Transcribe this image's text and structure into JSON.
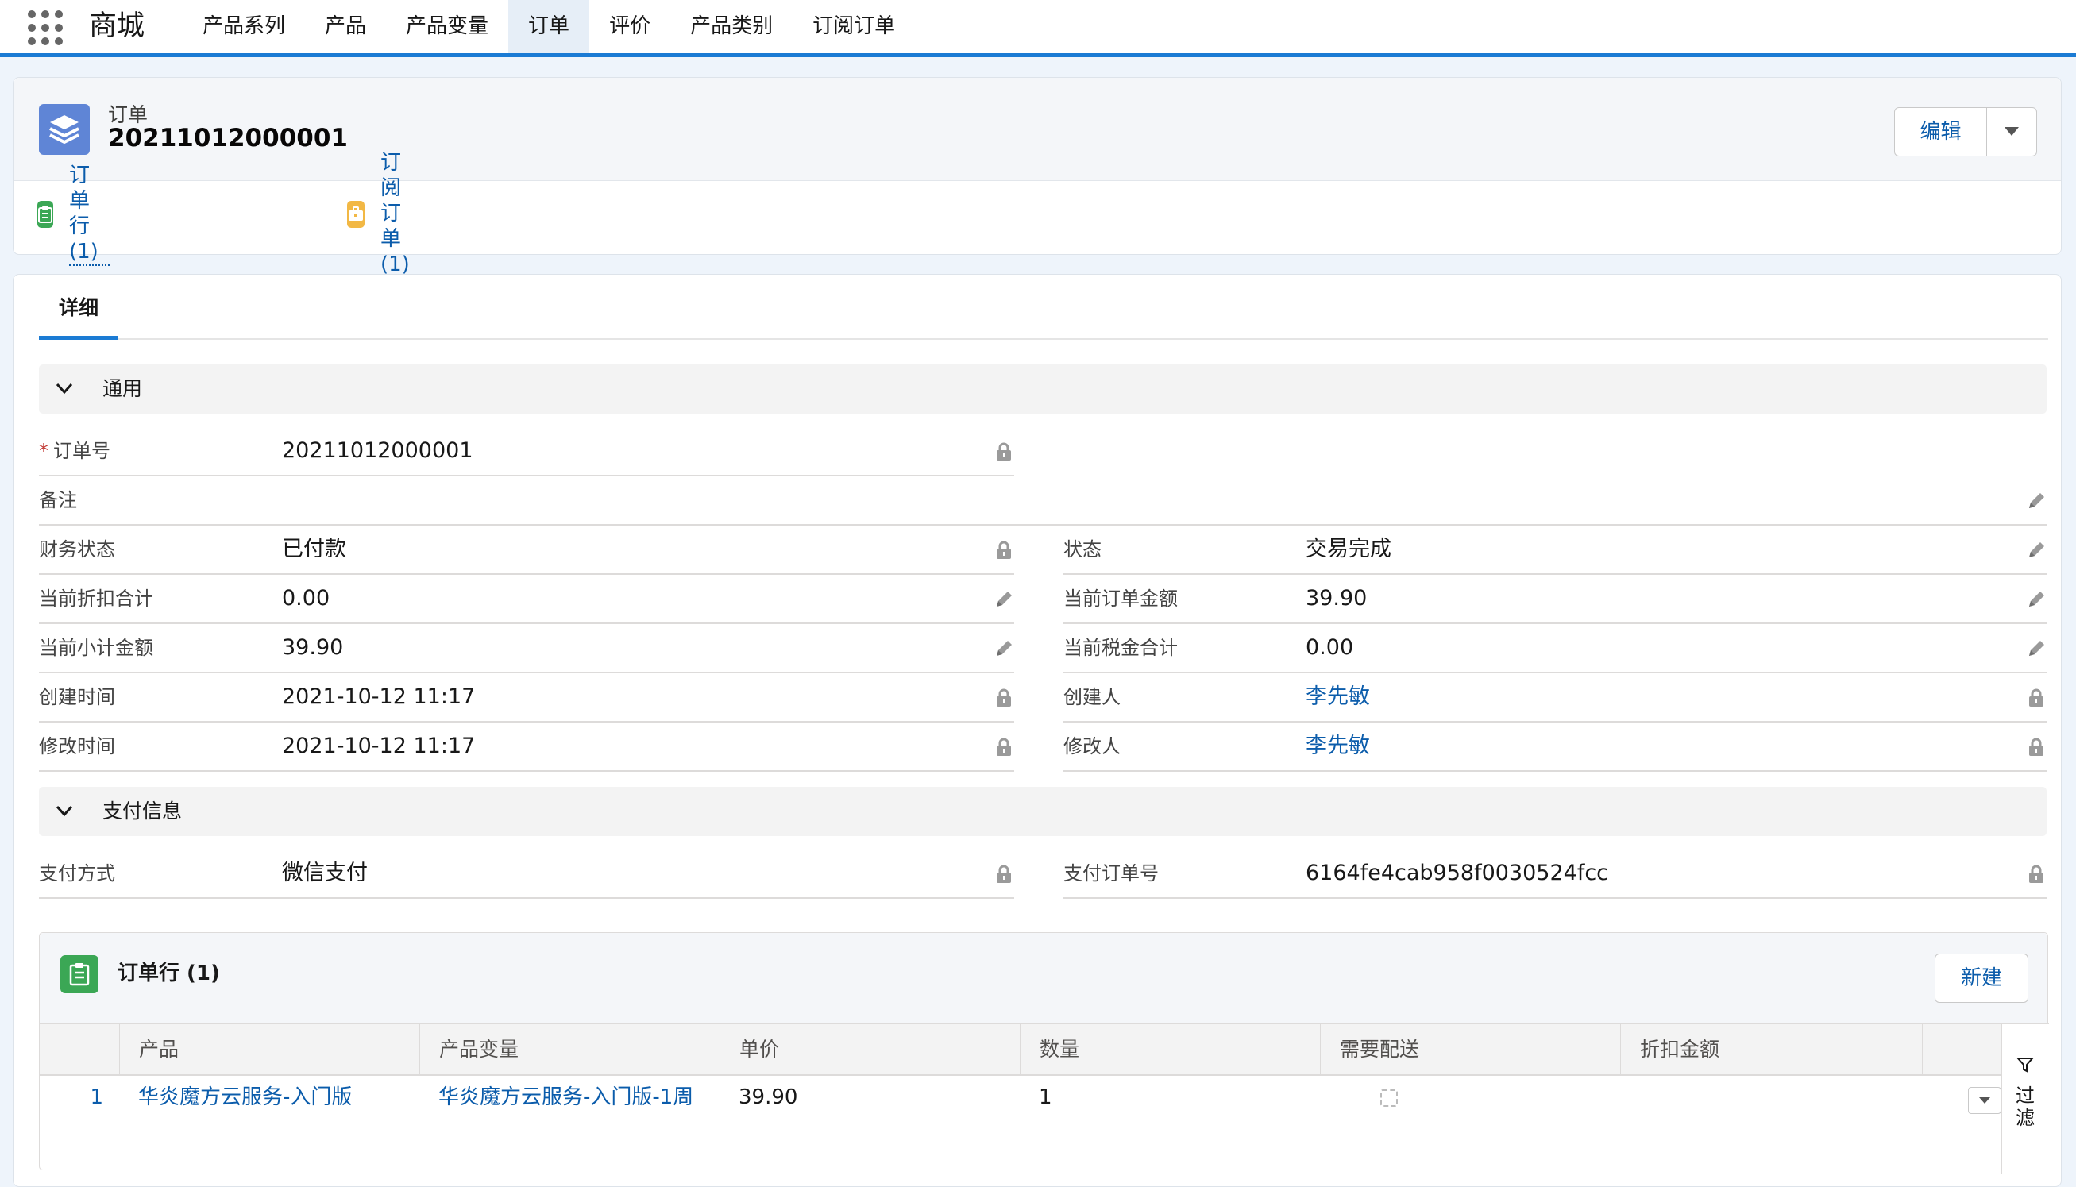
{
  "app": {
    "name": "商城"
  },
  "nav": {
    "items": [
      {
        "label": "产品系列",
        "active": false
      },
      {
        "label": "产品",
        "active": false
      },
      {
        "label": "产品变量",
        "active": false
      },
      {
        "label": "订单",
        "active": true
      },
      {
        "label": "评价",
        "active": false
      },
      {
        "label": "产品类别",
        "active": false
      },
      {
        "label": "订阅订单",
        "active": false
      }
    ]
  },
  "header": {
    "object_type": "订单",
    "record_name": "20211012000001",
    "edit_label": "编辑",
    "icon": "layers-icon"
  },
  "related_links": [
    {
      "label": "订单行(1)",
      "icon": "clipboard-icon",
      "color": "#3ba755"
    },
    {
      "label": "订阅订单(1)",
      "icon": "briefcase-icon",
      "color": "#f2b845"
    }
  ],
  "tabs": [
    {
      "label": "详细",
      "active": true
    }
  ],
  "sections": {
    "general": {
      "title": "通用"
    },
    "payment": {
      "title": "支付信息"
    }
  },
  "fields": {
    "order_no": {
      "label": "订单号",
      "value": "20211012000001",
      "required": true,
      "icon": "lock-icon"
    },
    "remark": {
      "label": "备注",
      "value": "",
      "icon": "pencil-icon"
    },
    "finance_status": {
      "label": "财务状态",
      "value": "已付款",
      "icon": "lock-icon"
    },
    "status": {
      "label": "状态",
      "value": "交易完成",
      "icon": "pencil-icon"
    },
    "discount_total": {
      "label": "当前折扣合计",
      "value": "0.00",
      "icon": "pencil-icon"
    },
    "order_amount": {
      "label": "当前订单金额",
      "value": "39.90",
      "icon": "pencil-icon"
    },
    "subtotal": {
      "label": "当前小计金额",
      "value": "39.90",
      "icon": "pencil-icon"
    },
    "tax_total": {
      "label": "当前税金合计",
      "value": "0.00",
      "icon": "pencil-icon"
    },
    "created_time": {
      "label": "创建时间",
      "value": "2021-10-12 11:17",
      "icon": "lock-icon"
    },
    "created_by": {
      "label": "创建人",
      "value": "李先敏",
      "icon": "lock-icon"
    },
    "modified_time": {
      "label": "修改时间",
      "value": "2021-10-12 11:17",
      "icon": "lock-icon"
    },
    "modified_by": {
      "label": "修改人",
      "value": "李先敏",
      "icon": "lock-icon"
    },
    "pay_method": {
      "label": "支付方式",
      "value": "微信支付",
      "icon": "lock-icon"
    },
    "pay_order_no": {
      "label": "支付订单号",
      "value": "6164fe4cab958f0030524fcc",
      "icon": "lock-icon"
    }
  },
  "related_list": {
    "title": "订单行 (1)",
    "new_label": "新建",
    "columns": [
      "产品",
      "产品变量",
      "单价",
      "数量",
      "需要配送",
      "折扣金额"
    ],
    "rows": [
      {
        "num": "1",
        "product": "华炎魔方云服务-入门版",
        "variant": "华炎魔方云服务-入门版-1周",
        "price": "39.90",
        "qty": "1",
        "delivery": false,
        "discount": ""
      }
    ],
    "filter_label": "过滤"
  },
  "colors": {
    "accent": "#1b7bd4",
    "link": "#0b5cab",
    "object_icon": "#5f85d6"
  }
}
